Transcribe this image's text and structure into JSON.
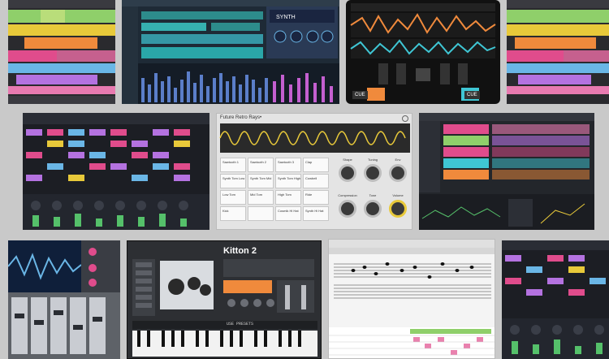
{
  "tiles": {
    "tile3": {
      "cue_left": "CUE",
      "cue_right": "CUE"
    },
    "tile6": {
      "title": "Future Retro Rays•",
      "grid": [
        [
          "Sawtooth 1",
          "Sawtooth 2",
          "Sawtooth 3",
          "Clap"
        ],
        [
          "Synth Tom Low",
          "Synth Tom Mid",
          "Synth Tom High",
          "Cowbell"
        ],
        [
          "Low Tom",
          "Mid Tom",
          "High Tom",
          "Ride"
        ],
        [
          "Kick",
          "",
          "Cosmik Hi Hat",
          "Synth Hi Hat"
        ]
      ],
      "knobs_top": [
        "Shape",
        "Tuning",
        "Env"
      ],
      "knobs_bottom": [
        "Compression",
        "Tone",
        "Volume"
      ]
    },
    "tile10": {
      "title": "Kitton 2",
      "button": "USE PRESETS"
    }
  },
  "colors": {
    "bg": "#c9c9c9",
    "accent_yellow": "#e8c93a",
    "accent_cyan": "#3fc6d4",
    "accent_orange": "#f08a3c",
    "accent_pink": "#e04c8c",
    "accent_purple": "#8b5cd6"
  }
}
